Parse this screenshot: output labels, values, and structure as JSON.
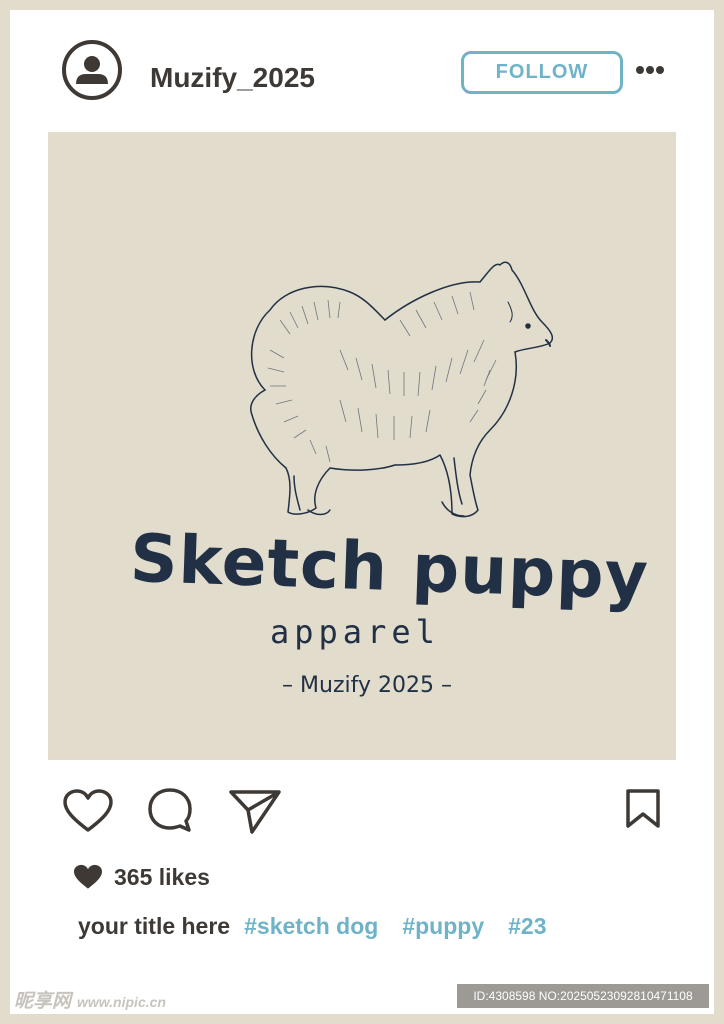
{
  "header": {
    "username": "Muzify_2025",
    "follow_label": "FOLLOW"
  },
  "post": {
    "brand_title": "Sketch puppy",
    "brand_subtitle": "apparel",
    "brand_credit": "– Muzify 2025 –"
  },
  "actions": {
    "icons": [
      "heart-outline-icon",
      "comment-icon",
      "send-icon",
      "bookmark-icon"
    ]
  },
  "stats": {
    "likes": "365 likes"
  },
  "caption": {
    "title": "your title here",
    "hashtags": [
      "#sketch dog",
      "#puppy",
      "#23"
    ]
  },
  "watermark": {
    "left_logo": "昵享网",
    "left_site": "www.nipic.cn",
    "right_id": "ID:4308598 NO:20250523092810471108"
  },
  "colors": {
    "accent": "#6fb3c8",
    "text_dark": "#3f3935",
    "frame": "#e2dccd",
    "image_bg": "#e1dccb",
    "ink": "#223046"
  }
}
